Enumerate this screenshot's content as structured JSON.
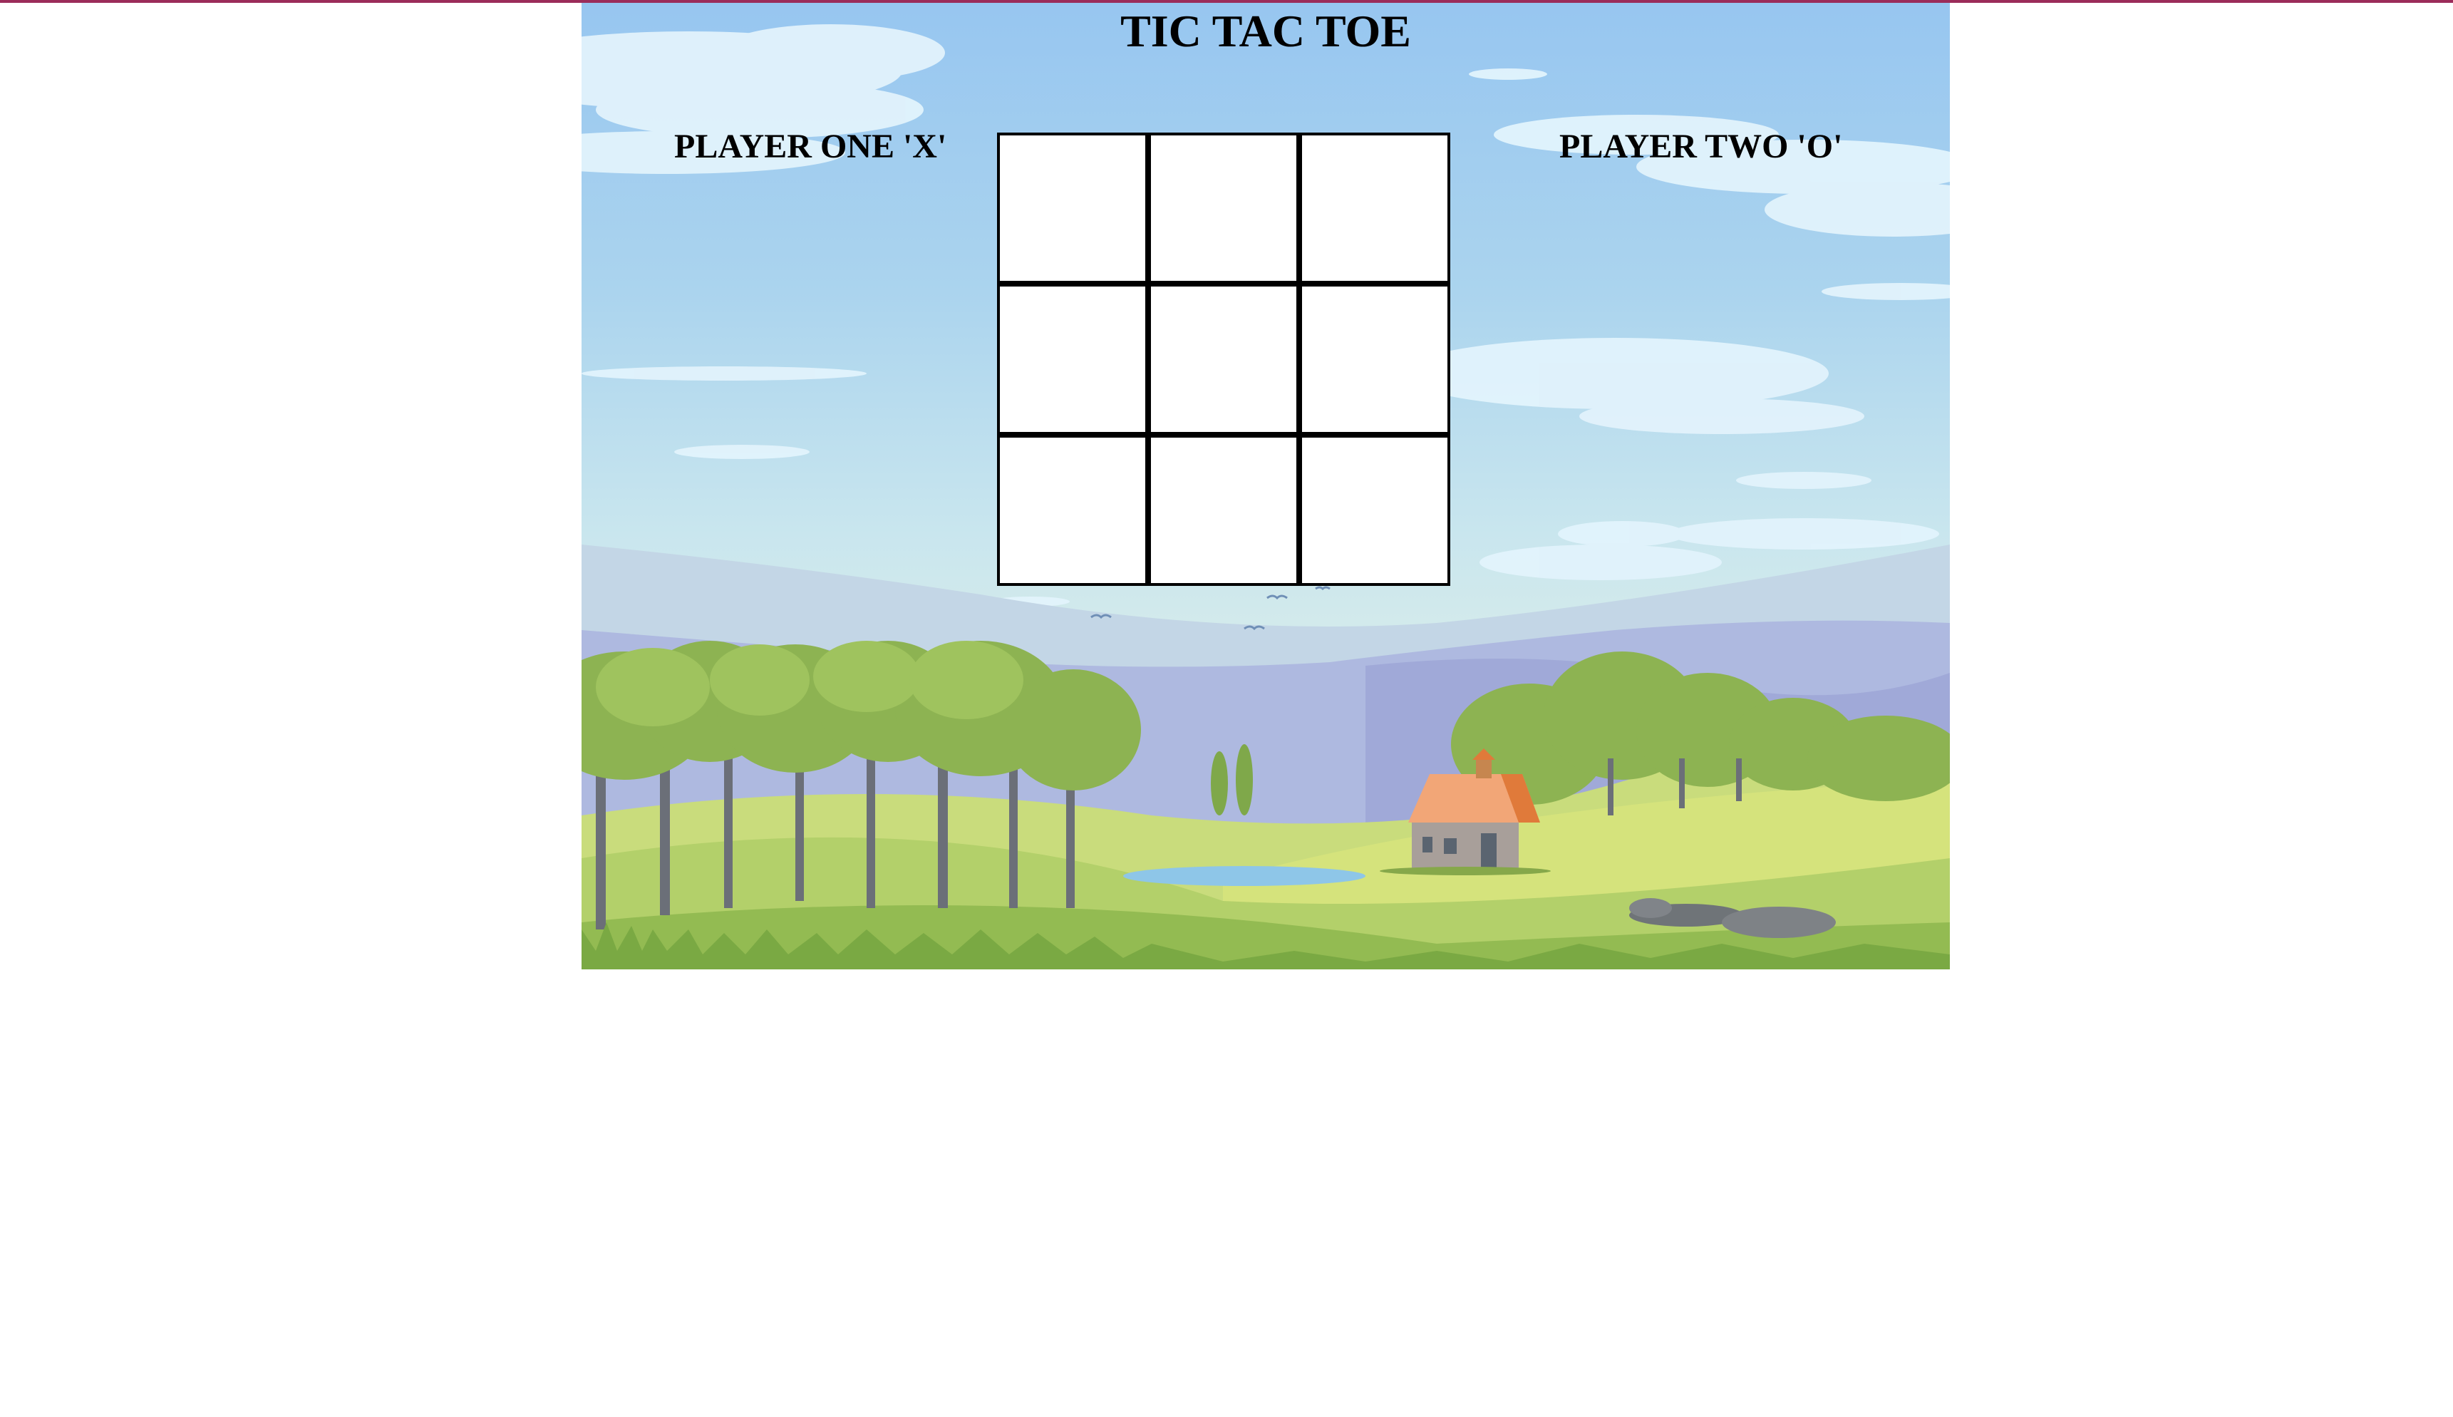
{
  "game": {
    "title": "TIC TAC TOE",
    "player_one_label": "PLAYER ONE 'X'",
    "player_two_label": "PLAYER TWO 'O'",
    "board": [
      "",
      "",
      "",
      "",
      "",
      "",
      "",
      "",
      ""
    ]
  },
  "colors": {
    "top_border": "#9b2c5a",
    "board_lines": "#000000",
    "cell_background": "#ffffff",
    "sky": "#97c6f0",
    "grass": "#9cc45a",
    "roof": "#f08c50"
  },
  "background": {
    "scene": "countryside landscape with trees, hills, a pond and a cottage"
  }
}
